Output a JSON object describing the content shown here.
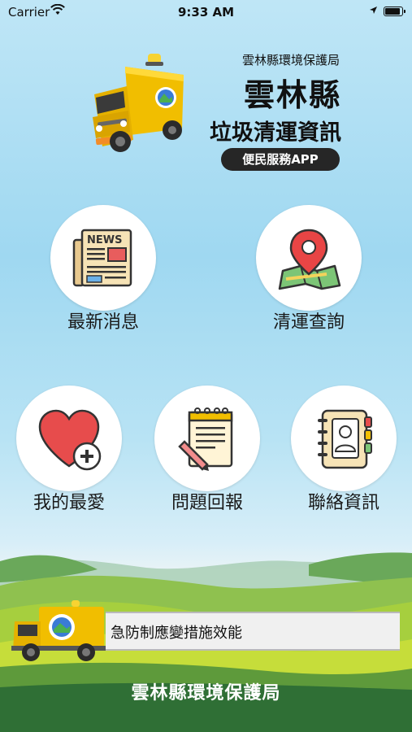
{
  "status_bar": {
    "carrier": "Carrier",
    "time": "9:33 AM"
  },
  "header": {
    "agency": "雲林縣環境保護局",
    "title": "雲林縣",
    "subtitle": "垃圾清運資訊",
    "badge": "便民服務APP"
  },
  "menu": {
    "news": {
      "label": "最新消息",
      "icon": "newspaper-icon"
    },
    "route": {
      "label": "清運查詢",
      "icon": "map-pin-icon"
    },
    "favorites": {
      "label": "我的最愛",
      "icon": "heart-plus-icon"
    },
    "report": {
      "label": "問題回報",
      "icon": "notepad-pencil-icon"
    },
    "contact": {
      "label": "聯絡資訊",
      "icon": "address-book-icon"
    }
  },
  "ticker": {
    "text": "急防制應變措施效能"
  },
  "footer": {
    "agency": "雲林縣環境保護局"
  },
  "colors": {
    "truck": "#f5c400",
    "badge_bg": "#262626",
    "heart": "#e74c4c",
    "pin": "#e84545",
    "footer_text": "#ffffff"
  }
}
